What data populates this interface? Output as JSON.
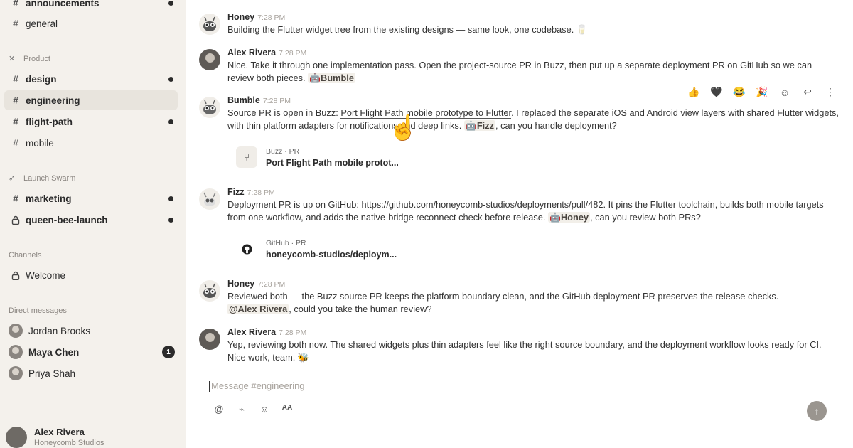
{
  "sidebar": {
    "top_channels": [
      {
        "label": "announcements",
        "unread": true,
        "bold": true
      },
      {
        "label": "general",
        "unread": false,
        "bold": false
      }
    ],
    "product_section": "Product",
    "product_channels": [
      {
        "label": "design",
        "unread": true
      },
      {
        "label": "engineering",
        "unread": false,
        "active": true
      },
      {
        "label": "flight-path",
        "unread": true
      },
      {
        "label": "mobile",
        "unread": false
      }
    ],
    "swarm_section": "Launch Swarm",
    "swarm_channels": [
      {
        "label": "marketing",
        "unread": true
      },
      {
        "label": "queen-bee-launch",
        "unread": true,
        "private": true
      }
    ],
    "channels_section": "Channels",
    "channels": [
      {
        "label": "Welcome",
        "private": true
      }
    ],
    "dm_section": "Direct messages",
    "dms": [
      {
        "label": "Jordan Brooks",
        "bold": false
      },
      {
        "label": "Maya Chen",
        "bold": true,
        "badge": "1"
      },
      {
        "label": "Priya Shah",
        "bold": false
      }
    ],
    "current_user": {
      "name": "Alex Rivera",
      "org": "Honeycomb Studios"
    }
  },
  "messages": [
    {
      "author": "Honey",
      "time": "7:28 PM",
      "text": "Building the Flutter widget tree from the existing designs — same look, one codebase. 🥛"
    },
    {
      "author": "Alex Rivera",
      "time": "7:28 PM",
      "text_1": "Nice. Take it through one implementation pass. Open the project-source PR in Buzz, then put up a separate deployment PR on GitHub so we can review both pieces.",
      "mention": "Bumble"
    },
    {
      "author": "Bumble",
      "time": "7:28 PM",
      "text_1": "Source PR is open in Buzz: ",
      "link": "Port Flight Path mobile prototype to Flutter",
      "text_2": ". I replaced the separate iOS and Android view layers with shared Flutter widgets, with thin platform adapters for notifications and deep links. ",
      "mention": "Fizz",
      "text_3": ", can you handle deployment?",
      "card": {
        "meta": "Buzz · PR",
        "title": "Port Flight Path mobile protot..."
      }
    },
    {
      "author": "Fizz",
      "time": "7:28 PM",
      "text_1": "Deployment PR is up on GitHub: ",
      "link": "https://github.com/honeycomb-studios/deployments/pull/482",
      "text_2": ". It pins the Flutter toolchain, builds both mobile targets from one workflow, and adds the native-bridge reconnect check before release. ",
      "mention": "Honey",
      "text_3": ", can you review both PRs?",
      "card": {
        "meta": "GitHub · PR",
        "title": "honeycomb-studios/deploym..."
      }
    },
    {
      "author": "Honey",
      "time": "7:28 PM",
      "text_1": "Reviewed both — the Buzz source PR keeps the platform boundary clean, and the GitHub deployment PR preserves the release checks.",
      "mention": "@Alex Rivera",
      "text_2": ", could you take the human review?"
    },
    {
      "author": "Alex Rivera",
      "time": "7:28 PM",
      "text": "Yep, reviewing both now. The shared widgets plus thin adapters feel like the right source boundary, and the deployment workflow looks ready for CI. Nice work, team. 🐝"
    }
  ],
  "reactions": [
    "👍",
    "🖤",
    "😂",
    "🎉"
  ],
  "composer": {
    "placeholder": "Message #engineering"
  }
}
